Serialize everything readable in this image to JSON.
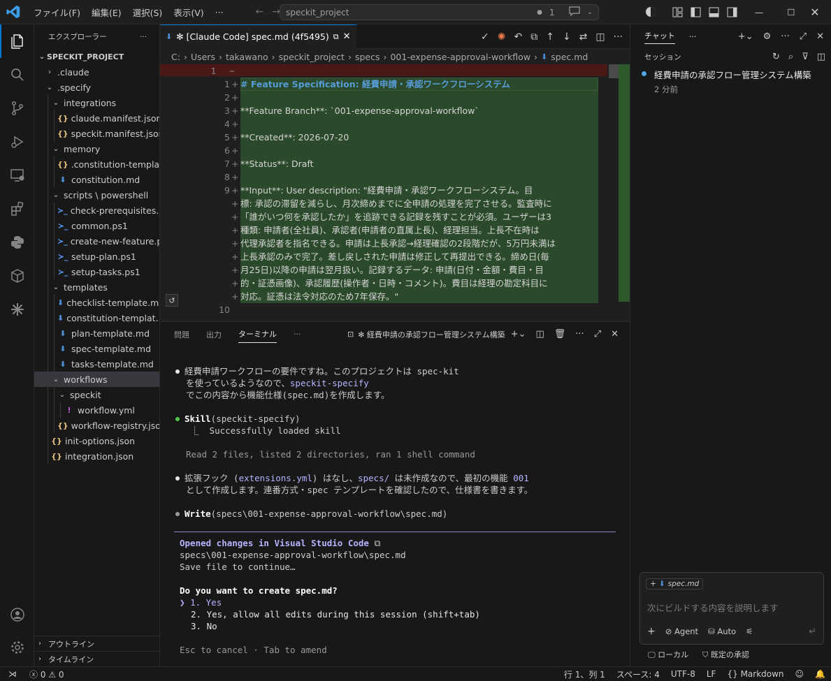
{
  "titlebar": {
    "menus": [
      "ファイル(F)",
      "編集(E)",
      "選択(S)",
      "表示(V)",
      "···"
    ],
    "search_text": "speckit_project",
    "badge_count": "1"
  },
  "explorer": {
    "header": "エクスプローラー",
    "project": "SPECKIT_PROJECT",
    "tree": [
      {
        "label": ".claude",
        "depth": 1,
        "kind": "folder-closed"
      },
      {
        "label": ".specify",
        "depth": 1,
        "kind": "folder-open"
      },
      {
        "label": "integrations",
        "depth": 2,
        "kind": "folder-open"
      },
      {
        "label": "claude.manifest.json",
        "depth": 3,
        "kind": "json"
      },
      {
        "label": "speckit.manifest.json",
        "depth": 3,
        "kind": "json"
      },
      {
        "label": "memory",
        "depth": 2,
        "kind": "folder-open"
      },
      {
        "label": ".constitution-templat...",
        "depth": 3,
        "kind": "json"
      },
      {
        "label": "constitution.md",
        "depth": 3,
        "kind": "md"
      },
      {
        "label": "scripts \\ powershell",
        "depth": 2,
        "kind": "folder-open"
      },
      {
        "label": "check-prerequisites.p...",
        "depth": 3,
        "kind": "ps"
      },
      {
        "label": "common.ps1",
        "depth": 3,
        "kind": "ps"
      },
      {
        "label": "create-new-feature.ps1",
        "depth": 3,
        "kind": "ps"
      },
      {
        "label": "setup-plan.ps1",
        "depth": 3,
        "kind": "ps"
      },
      {
        "label": "setup-tasks.ps1",
        "depth": 3,
        "kind": "ps"
      },
      {
        "label": "templates",
        "depth": 2,
        "kind": "folder-open"
      },
      {
        "label": "checklist-template.md",
        "depth": 3,
        "kind": "md"
      },
      {
        "label": "constitution-templat...",
        "depth": 3,
        "kind": "md"
      },
      {
        "label": "plan-template.md",
        "depth": 3,
        "kind": "md"
      },
      {
        "label": "spec-template.md",
        "depth": 3,
        "kind": "md"
      },
      {
        "label": "tasks-template.md",
        "depth": 3,
        "kind": "md"
      },
      {
        "label": "workflows",
        "depth": 2,
        "kind": "folder-open",
        "selected": true
      },
      {
        "label": "speckit",
        "depth": 3,
        "kind": "folder-open"
      },
      {
        "label": "workflow.yml",
        "depth": 4,
        "kind": "yml"
      },
      {
        "label": "workflow-registry.json",
        "depth": 3,
        "kind": "json"
      },
      {
        "label": "init-options.json",
        "depth": 2,
        "kind": "json"
      },
      {
        "label": "integration.json",
        "depth": 2,
        "kind": "json"
      }
    ],
    "outline": "アウトライン",
    "timeline": "タイムライン"
  },
  "editor": {
    "tab_label": "✻ [Claude Code] spec.md (4f5495)",
    "breadcrumb": [
      "C:",
      "Users",
      "takawano",
      "speckit_project",
      "specs",
      "001-expense-approval-workflow",
      "spec.md"
    ],
    "removed_line_number": "1",
    "lines": [
      {
        "n": "1",
        "text": "# Feature Specification: 経費申請・承認ワークフローシステム"
      },
      {
        "n": "2",
        "text": ""
      },
      {
        "n": "3",
        "text": "**Feature Branch**: `001-expense-approval-workflow`"
      },
      {
        "n": "4",
        "text": ""
      },
      {
        "n": "5",
        "text": "**Created**: 2026-07-20"
      },
      {
        "n": "6",
        "text": ""
      },
      {
        "n": "7",
        "text": "**Status**: Draft"
      },
      {
        "n": "8",
        "text": ""
      },
      {
        "n": "9",
        "text": "**Input**: User description: \"経費申請・承認ワークフローシステム。目"
      },
      {
        "n": "",
        "text": "標: 承認の滞留を減らし、月次締めまでに全申請の処理を完了させる。監査時に"
      },
      {
        "n": "",
        "text": "「誰がいつ何を承認したか」を追跡できる記録を残すことが必須。ユーザーは3"
      },
      {
        "n": "",
        "text": "種類: 申請者(全社員)、承認者(申請者の直属上長)、経理担当。上長不在時は"
      },
      {
        "n": "",
        "text": "代理承認者を指名できる。申請は上長承認→経理確認の2段階だが、5万円未満は"
      },
      {
        "n": "",
        "text": "上長承認のみで完了。差し戻しされた申請は修正して再提出できる。締め日(毎"
      },
      {
        "n": "",
        "text": "月25日)以降の申請は翌月扱い。記録するデータ: 申請(日付・金額・費目・目"
      },
      {
        "n": "",
        "text": "的・証憑画像)、承認履歴(操作者・日時・コメント)。費目は経理の勘定科目に"
      },
      {
        "n": "",
        "text": "対応。証憑は法令対応のため7年保存。\""
      },
      {
        "n": "10",
        "text": ""
      }
    ]
  },
  "panel": {
    "tabs": [
      "問題",
      "出力",
      "ターミナル",
      "···"
    ],
    "terminal_title": "✻ 経費申請の承認フロー管理システム構築",
    "msg1": [
      "経費申請ワークフローの要件ですね。このプロジェクトは spec-kit",
      "を使っているようなので、",
      "speckit-specify",
      "でこの内容から機能仕様(spec.md)を作成します。"
    ],
    "skill_call": "Skill",
    "skill_arg": "(speckit-specify)",
    "skill_result": "⎿  Successfully loaded skill",
    "read_summary": "Read 2 files, listed 2 directories, ran 1 shell command",
    "msg2a_pre": "拡張フック (",
    "msg2a_code1": "extensions.yml",
    "msg2a_mid": ") はなし、",
    "msg2a_code2": "specs/",
    "msg2a_mid2": " は未作成なので、最初の機能 ",
    "msg2a_code3": "001",
    "msg2b": "として作成します。連番方式・spec テンプレートを確認したので、仕様書を書きます。",
    "write_call": "Write",
    "write_arg": "(specs\\001-expense-approval-workflow\\spec.md)",
    "opened": "Opened changes in Visual Studio Code",
    "opened_path": "specs\\001-expense-approval-workflow\\spec.md",
    "save_hint": "Save file to continue…",
    "question": "Do you want to create spec.md?",
    "options": [
      "1. Yes",
      "2. Yes, allow all edits during this session (shift+tab)",
      "3. No"
    ],
    "footer": "Esc to cancel · Tab to amend"
  },
  "chat": {
    "title": "チャット",
    "sessions_label": "セッション",
    "session_title": "経費申請の承認フロー管理システム構築",
    "session_time": "2 分前",
    "attachment": "spec.md",
    "placeholder": "次にビルドする内容を説明します",
    "agent": "Agent",
    "auto": "Auto",
    "local": "ローカル",
    "approval": "既定の承認"
  },
  "status": {
    "errors": "0",
    "warnings": "0",
    "position": "行 1、列 1",
    "spaces": "スペース: 4",
    "encoding": "UTF-8",
    "eol": "LF",
    "language": "Markdown"
  }
}
